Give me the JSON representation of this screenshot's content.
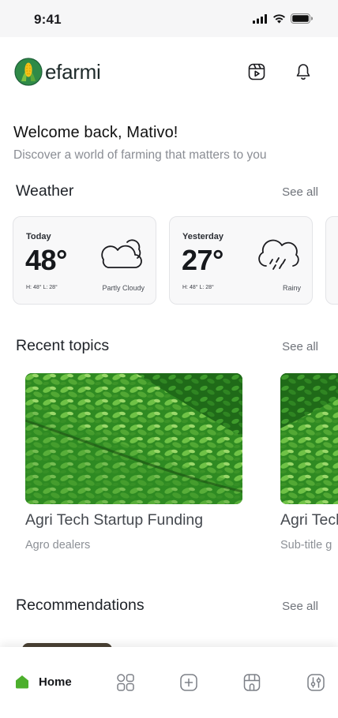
{
  "status": {
    "time": "9:41"
  },
  "brand": {
    "name": "efarmi",
    "primary": "#1f5f3a",
    "accent": "#f4c21a",
    "home_green": "#4caf2c"
  },
  "header": {
    "icons": [
      "video-play-icon",
      "bell-icon"
    ]
  },
  "welcome": {
    "title": "Welcome back, Mativo!",
    "subtitle": "Discover a world of farming that matters to you"
  },
  "weather": {
    "title": "Weather",
    "see_all": "See all",
    "cards": [
      {
        "day": "Today",
        "temp": "48°",
        "hilo": "H: 48° L: 28°",
        "condition": "Partly Cloudy",
        "icon": "partly-cloudy-icon"
      },
      {
        "day": "Yesterday",
        "temp": "27°",
        "hilo": "H: 48° L: 28°",
        "condition": "Rainy",
        "icon": "rain-cloud-icon"
      }
    ]
  },
  "topics": {
    "title": "Recent topics",
    "see_all": "See all",
    "items": [
      {
        "title": "Agri Tech Startup Funding",
        "subtitle": "Agro dealers"
      },
      {
        "title": "Agri Tech",
        "subtitle": "Sub-title g"
      }
    ]
  },
  "recommendations": {
    "title": "Recommendations",
    "see_all": "See all"
  },
  "nav": {
    "home_label": "Home",
    "items": [
      "home-icon",
      "grid-icon",
      "add-icon",
      "store-icon",
      "settings-sliders-icon"
    ]
  }
}
